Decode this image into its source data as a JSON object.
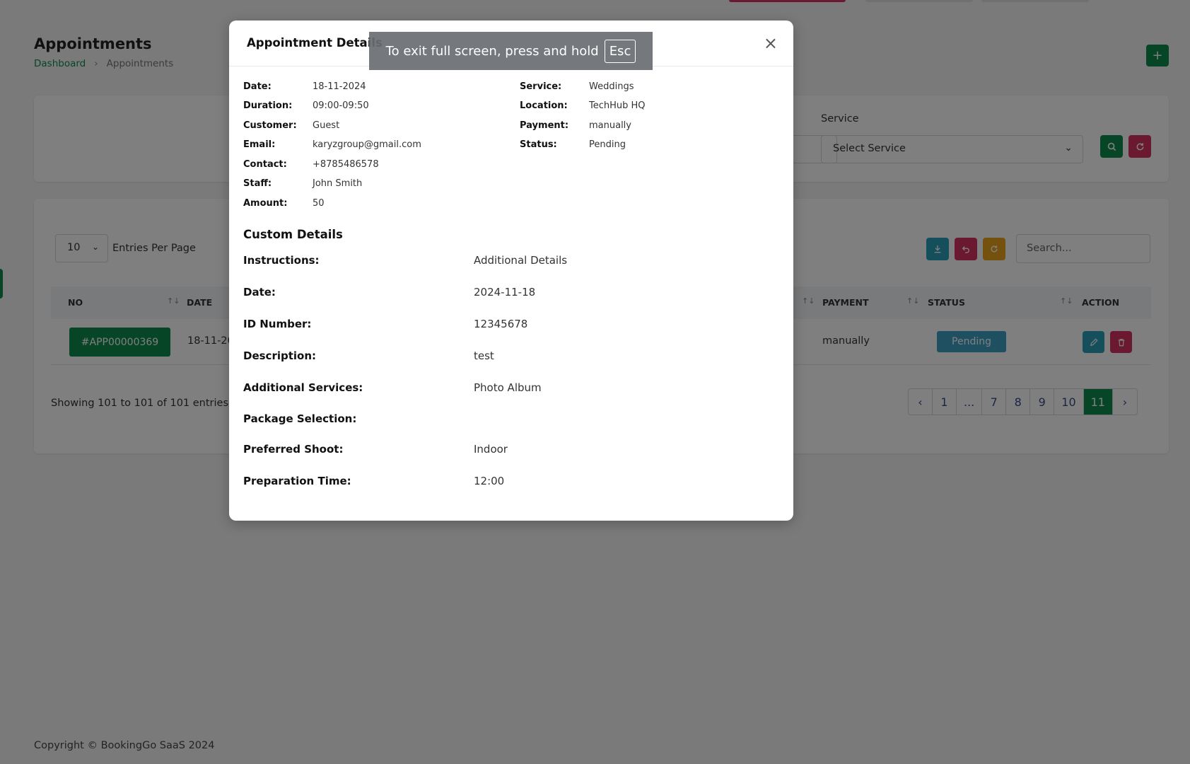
{
  "page": {
    "title": "Appointments",
    "breadcrumb": [
      "Dashboard",
      "Appointments"
    ],
    "add_icon": "+"
  },
  "filters": {
    "service_label": "Service",
    "service_value": "Select Service"
  },
  "list": {
    "entries_value": "10",
    "entries_label": "Entries Per Page",
    "search_placeholder": "Search...",
    "columns": {
      "no": "NO",
      "date": "DATE",
      "payment": "PAYMENT",
      "status": "STATUS",
      "action": "ACTION"
    },
    "row": {
      "no": "#APP00000369",
      "date": "18-11-2024",
      "payment": "manually",
      "status": "Pending"
    },
    "showing": "Showing 101 to 101 of 101 entries",
    "pagination": [
      "‹",
      "1",
      "...",
      "7",
      "8",
      "9",
      "10",
      "11",
      "›"
    ],
    "active_page": "11"
  },
  "footer": "Copyright © BookingGo SaaS 2024",
  "modal": {
    "title": "Appointment Details",
    "close_icon": "×",
    "left": [
      {
        "label": "Date:",
        "value": "18-11-2024"
      },
      {
        "label": "Duration:",
        "value": "09:00-09:50"
      },
      {
        "label": "Customer:",
        "value": "Guest"
      },
      {
        "label": "Email:",
        "value": "karyzgroup@gmail.com"
      },
      {
        "label": "Contact:",
        "value": "+8785486578"
      },
      {
        "label": "Staff:",
        "value": "John Smith"
      },
      {
        "label": "Amount:",
        "value": "50"
      }
    ],
    "right": [
      {
        "label": "Service:",
        "value": "Weddings"
      },
      {
        "label": "Location:",
        "value": "TechHub HQ"
      },
      {
        "label": "Payment:",
        "value": "manually"
      },
      {
        "label": "Status:",
        "value": "Pending"
      }
    ],
    "custom_title": "Custom Details",
    "custom": [
      {
        "label": "Instructions:",
        "value": "Additional Details"
      },
      {
        "label": "Date:",
        "value": "2024-11-18"
      },
      {
        "label": "ID Number:",
        "value": "12345678"
      },
      {
        "label": "Description:",
        "value": "test"
      },
      {
        "label": "Additional Services:",
        "value": "Photo Album"
      },
      {
        "label": "Package Selection:",
        "value": ""
      },
      {
        "label": "Preferred Shoot:",
        "value": "Indoor"
      },
      {
        "label": "Preparation Time:",
        "value": "12:00"
      }
    ]
  },
  "fullscreen_toast": {
    "text": "To exit full screen, press and hold",
    "key": "Esc"
  },
  "colors": {
    "primary": "#0d8a4a",
    "danger": "#d63361",
    "info": "#2b9fb6",
    "warning": "#e8a21a",
    "status_pending": "#3da0c2"
  },
  "icons": {
    "download": "download-icon",
    "undo": "undo-icon",
    "refresh": "refresh-icon",
    "search": "search-icon",
    "edit": "pencil-icon",
    "delete": "trash-icon"
  }
}
